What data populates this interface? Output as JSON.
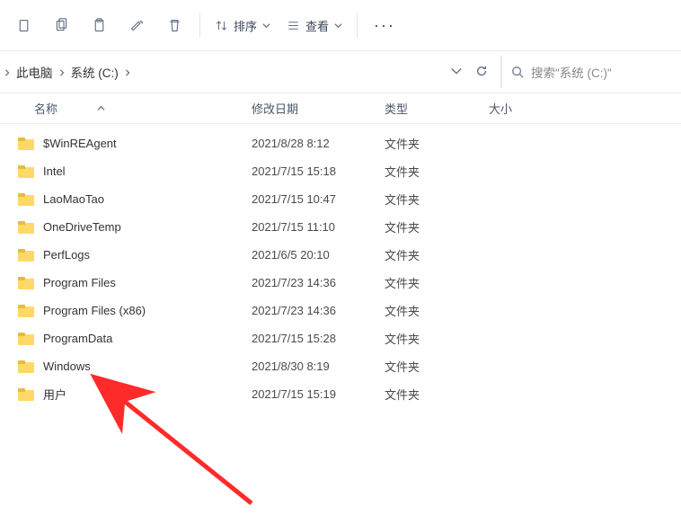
{
  "toolbar": {
    "sort_label": "排序",
    "view_label": "查看"
  },
  "breadcrumb": {
    "items": [
      "此电脑",
      "系统 (C:)"
    ]
  },
  "search": {
    "placeholder": "搜索\"系统 (C:)\""
  },
  "columns": {
    "name": "名称",
    "date": "修改日期",
    "type": "类型",
    "size": "大小"
  },
  "rows": [
    {
      "name": "$WinREAgent",
      "date": "2021/8/28 8:12",
      "type": "文件夹"
    },
    {
      "name": "Intel",
      "date": "2021/7/15 15:18",
      "type": "文件夹"
    },
    {
      "name": "LaoMaoTao",
      "date": "2021/7/15 10:47",
      "type": "文件夹"
    },
    {
      "name": "OneDriveTemp",
      "date": "2021/7/15 11:10",
      "type": "文件夹"
    },
    {
      "name": "PerfLogs",
      "date": "2021/6/5 20:10",
      "type": "文件夹"
    },
    {
      "name": "Program Files",
      "date": "2021/7/23 14:36",
      "type": "文件夹"
    },
    {
      "name": "Program Files (x86)",
      "date": "2021/7/23 14:36",
      "type": "文件夹"
    },
    {
      "name": "ProgramData",
      "date": "2021/7/15 15:28",
      "type": "文件夹"
    },
    {
      "name": "Windows",
      "date": "2021/8/30 8:19",
      "type": "文件夹"
    },
    {
      "name": "用户",
      "date": "2021/7/15 15:19",
      "type": "文件夹"
    }
  ]
}
